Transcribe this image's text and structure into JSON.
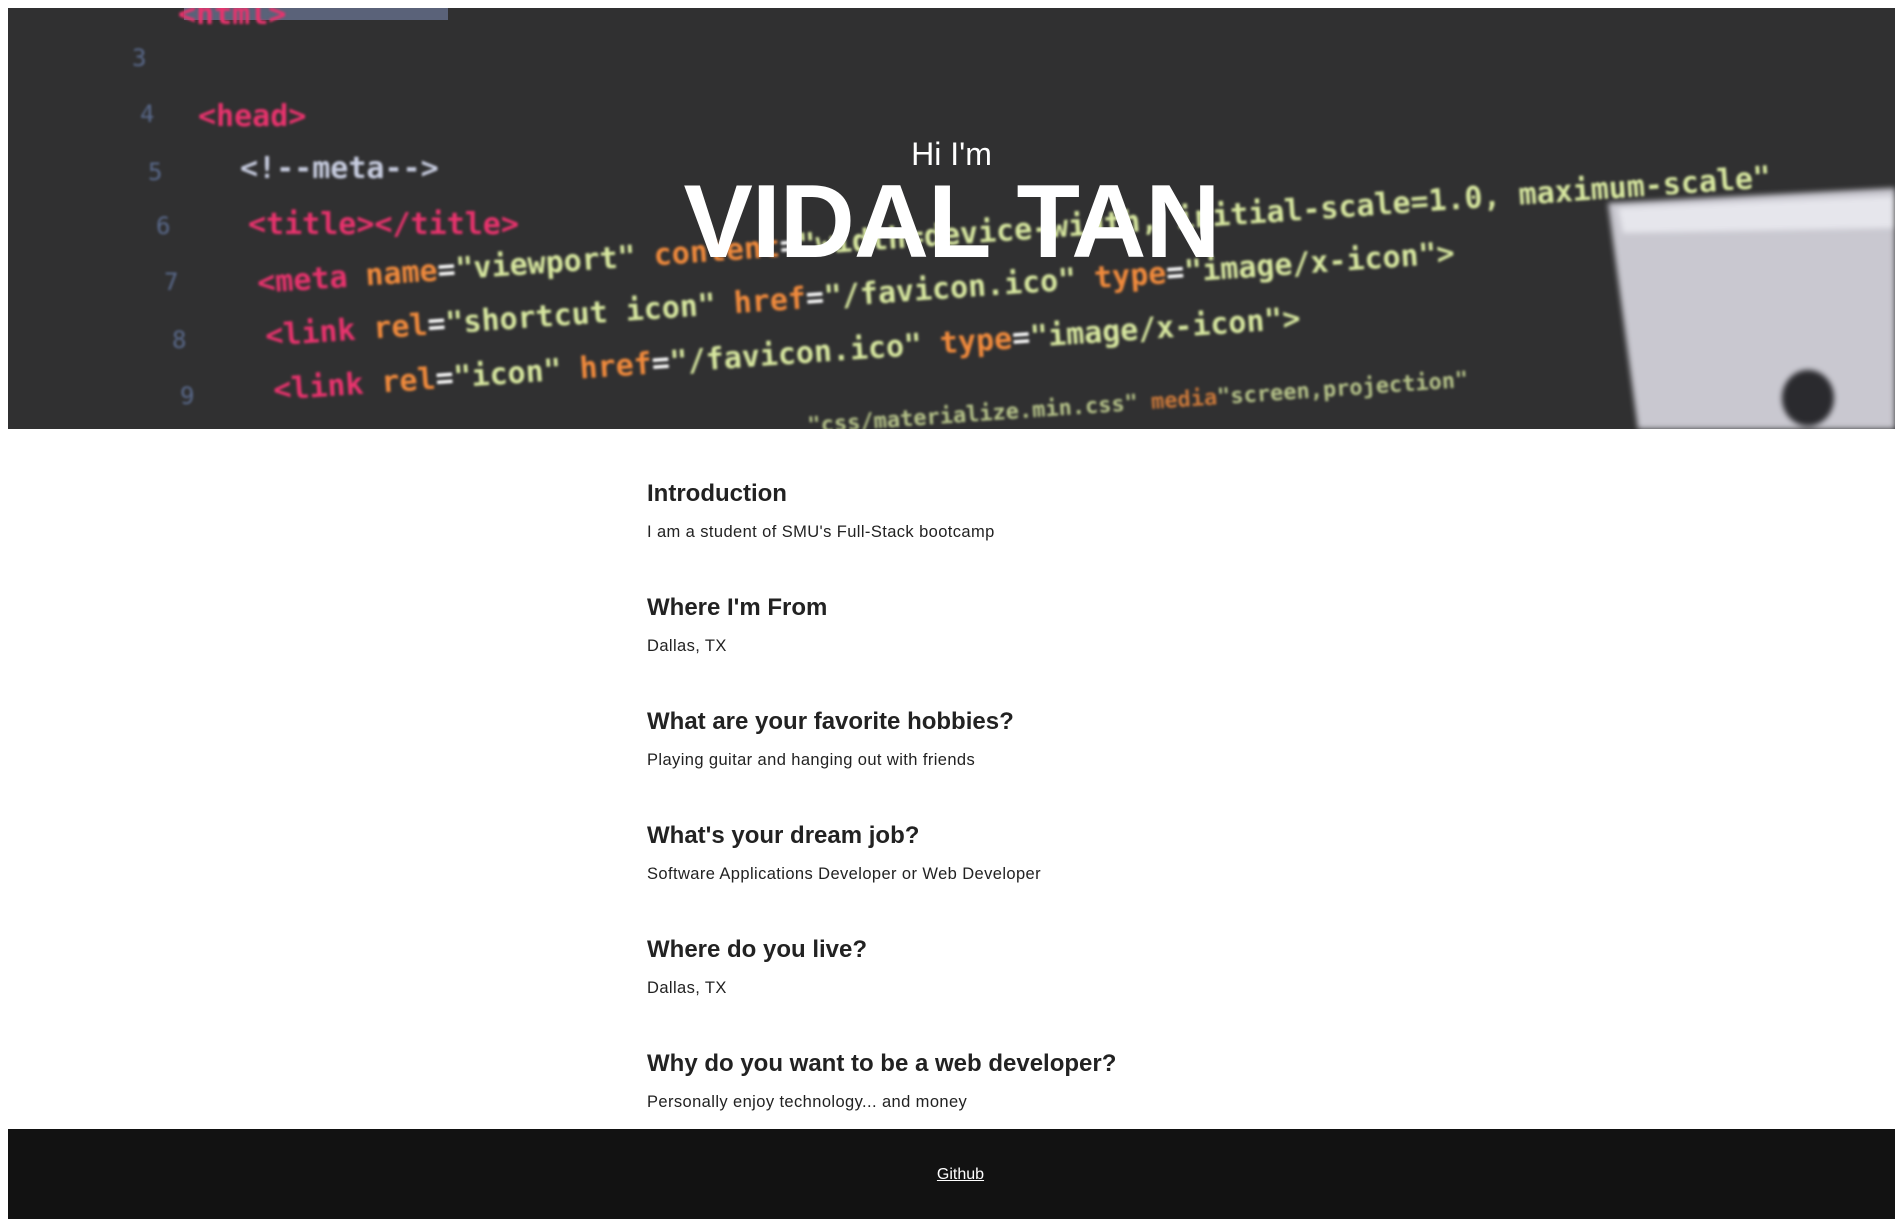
{
  "hero": {
    "greeting": "Hi I'm",
    "name": "VIDAL TAN"
  },
  "sections": [
    {
      "heading": "Introduction",
      "text": "I am a student of SMU's Full-Stack bootcamp"
    },
    {
      "heading": "Where I'm From",
      "text": "Dallas, TX"
    },
    {
      "heading": "What are your favorite hobbies?",
      "text": "Playing guitar and hanging out with friends"
    },
    {
      "heading": "What's your dream job?",
      "text": "Software Applications Developer or Web Developer"
    },
    {
      "heading": "Where do you live?",
      "text": "Dallas, TX"
    },
    {
      "heading": "Why do you want to be a web developer?",
      "text": "Personally enjoy technology... and money"
    }
  ],
  "footer": {
    "link_label": "Github"
  },
  "colors": {
    "hero_background": "#2f2f30",
    "footer_background": "#121212",
    "text": "#222222",
    "code_tag": "#e8336d",
    "code_attr": "#f08a3c",
    "code_string": "#d8e8a0"
  }
}
